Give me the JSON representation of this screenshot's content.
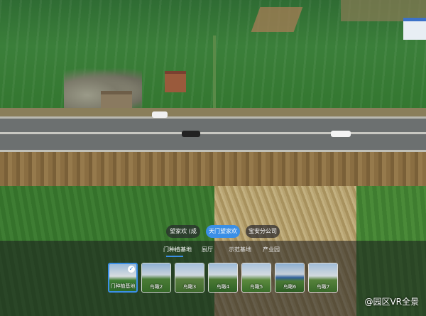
{
  "scene_groups": [
    {
      "label": "望家欢 (成"
    },
    {
      "label": "天门望家欢"
    },
    {
      "label": "宝安分公司"
    }
  ],
  "active_group_index": 1,
  "subtabs": [
    {
      "label": "门种植基地"
    },
    {
      "label": "厨厅"
    },
    {
      "label": "示范基地"
    },
    {
      "label": "产业园"
    }
  ],
  "active_subtab_index": 0,
  "thumbnails": [
    {
      "label": "门种植基地",
      "selected": true
    },
    {
      "label": "鸟瞰2",
      "selected": false
    },
    {
      "label": "鸟瞰3",
      "selected": false
    },
    {
      "label": "鸟瞰4",
      "selected": false
    },
    {
      "label": "鸟瞰5",
      "selected": false
    },
    {
      "label": "鸟瞰6",
      "selected": false
    },
    {
      "label": "鸟瞰7",
      "selected": false
    }
  ],
  "watermark": "@园区VR全景",
  "colors": {
    "accent": "#3b8fe6"
  },
  "icons": {
    "selected": "check-icon"
  }
}
